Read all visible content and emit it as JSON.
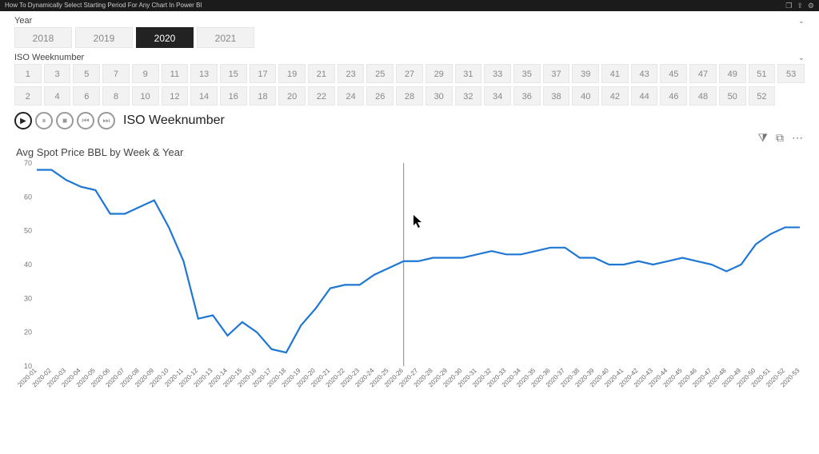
{
  "topbar": {
    "title": "How To Dynamically Select Starting Period For Any Chart In Power BI",
    "icons": [
      "❐",
      "⇪",
      "⚙"
    ]
  },
  "year_slicer": {
    "label": "Year",
    "options": [
      "2018",
      "2019",
      "2020",
      "2021"
    ],
    "selected": "2020"
  },
  "week_slicer": {
    "label": "ISO Weeknumber",
    "rows": [
      [
        "1",
        "3",
        "5",
        "7",
        "9",
        "11",
        "13",
        "15",
        "17",
        "19",
        "21",
        "23",
        "25",
        "27",
        "29",
        "31",
        "33",
        "35",
        "37",
        "39",
        "41",
        "43",
        "45",
        "47",
        "49",
        "51",
        "53"
      ],
      [
        "2",
        "4",
        "6",
        "8",
        "10",
        "12",
        "14",
        "16",
        "18",
        "20",
        "22",
        "24",
        "26",
        "28",
        "30",
        "32",
        "34",
        "36",
        "38",
        "40",
        "42",
        "44",
        "46",
        "48",
        "50",
        "52",
        ""
      ]
    ]
  },
  "playaxis": {
    "label": "ISO Weeknumber",
    "buttons": [
      {
        "name": "play-icon",
        "glyph": "▶",
        "active": true
      },
      {
        "name": "pause-icon",
        "glyph": "⏸",
        "active": false
      },
      {
        "name": "stop-icon",
        "glyph": "■",
        "active": false
      },
      {
        "name": "prev-icon",
        "glyph": "⏮",
        "active": false
      },
      {
        "name": "next-icon",
        "glyph": "⏭",
        "active": false
      }
    ]
  },
  "chart_toolbar": {
    "filter": "⧩",
    "focus": "⧉",
    "more": "⋯"
  },
  "chart_data": {
    "type": "line",
    "title": "Avg Spot Price BBL by Week & Year",
    "xlabel": "",
    "ylabel": "",
    "ylim": [
      10,
      70
    ],
    "yticks": [
      10,
      20,
      30,
      40,
      50,
      60,
      70
    ],
    "marker_at_index": 25,
    "categories": [
      "2020-01",
      "2020-02",
      "2020-03",
      "2020-04",
      "2020-05",
      "2020-06",
      "2020-07",
      "2020-08",
      "2020-09",
      "2020-10",
      "2020-11",
      "2020-12",
      "2020-13",
      "2020-14",
      "2020-15",
      "2020-16",
      "2020-17",
      "2020-18",
      "2020-19",
      "2020-20",
      "2020-21",
      "2020-22",
      "2020-23",
      "2020-24",
      "2020-25",
      "2020-26",
      "2020-27",
      "2020-28",
      "2020-29",
      "2020-30",
      "2020-31",
      "2020-32",
      "2020-33",
      "2020-34",
      "2020-35",
      "2020-36",
      "2020-37",
      "2020-38",
      "2020-39",
      "2020-40",
      "2020-41",
      "2020-42",
      "2020-43",
      "2020-44",
      "2020-45",
      "2020-46",
      "2020-47",
      "2020-48",
      "2020-49",
      "2020-50",
      "2020-51",
      "2020-52",
      "2020-53"
    ],
    "series": [
      {
        "name": "Avg Spot Price BBL",
        "color": "#1f77d4",
        "values": [
          68,
          68,
          65,
          63,
          62,
          55,
          55,
          57,
          59,
          51,
          41,
          24,
          25,
          19,
          23,
          20,
          15,
          14,
          22,
          27,
          33,
          34,
          34,
          37,
          39,
          41,
          41,
          42,
          42,
          42,
          43,
          44,
          43,
          43,
          44,
          45,
          45,
          42,
          42,
          40,
          40,
          41,
          40,
          41,
          42,
          41,
          40,
          38,
          40,
          46,
          49,
          51,
          51
        ]
      }
    ]
  }
}
